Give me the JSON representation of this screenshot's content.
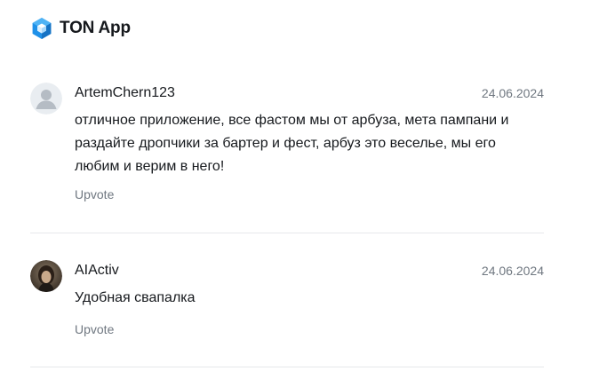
{
  "header": {
    "app_title": "TON App",
    "logo_icon": "ton-app-logo-icon",
    "accent_color": "#1e90e8"
  },
  "reviews": [
    {
      "author": "ArtemChern123",
      "date": "24.06.2024",
      "text": "отличное приложение, все фастом мы от арбуза, мета пампани и раздайте дропчики за бартер и фест, арбуз это веселье, мы его любим и верим в него!",
      "upvote_label": "Upvote",
      "avatar": "default-user-avatar-icon"
    },
    {
      "author": "AIActiv",
      "date": "24.06.2024",
      "text": "Удобная свапалка",
      "upvote_label": "Upvote",
      "avatar": "photo-avatar"
    }
  ]
}
